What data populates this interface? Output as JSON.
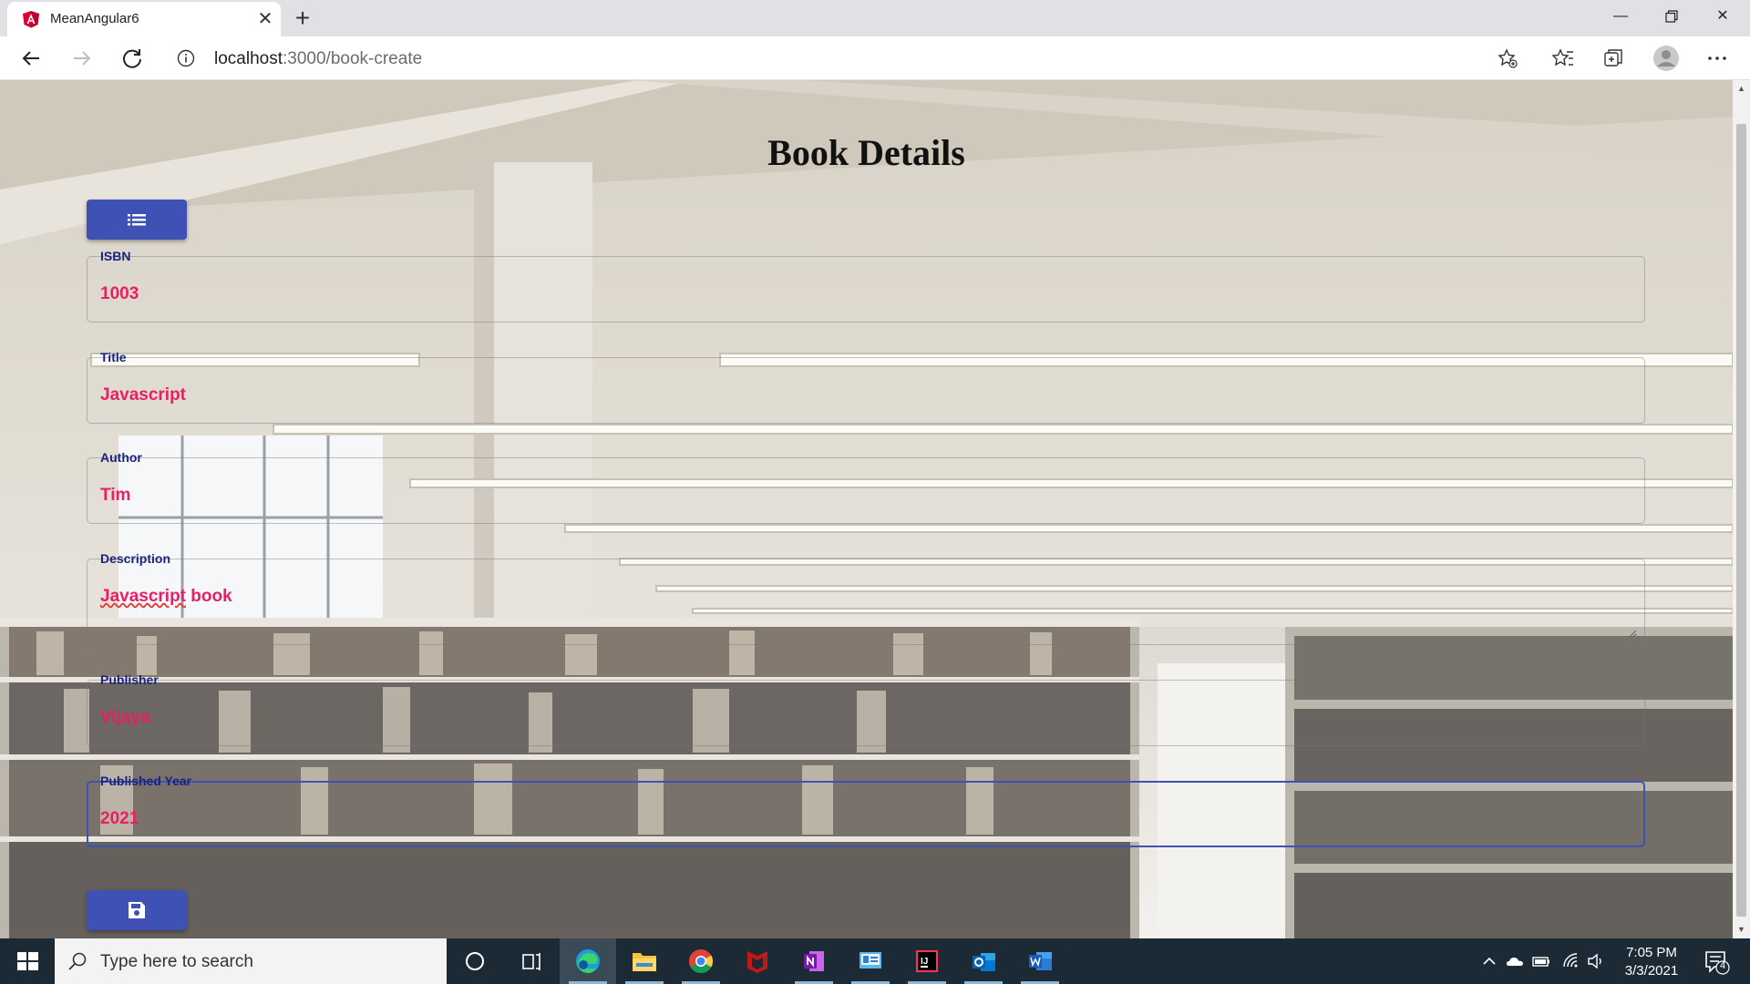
{
  "browser": {
    "tab_title": "MeanAngular6",
    "url_host": "localhost",
    "url_path": ":3000/book-create"
  },
  "page": {
    "heading": "Book Details",
    "fields": {
      "isbn": {
        "label": "ISBN",
        "value": "1003"
      },
      "title": {
        "label": "Title",
        "value": "Javascript"
      },
      "author": {
        "label": "Author",
        "value": "Tim"
      },
      "description": {
        "label": "Description",
        "value_word1": "Javascript",
        "value_rest": " book"
      },
      "publisher": {
        "label": "Publisher",
        "value": "Vijaya"
      },
      "published_year": {
        "label": "Published Year",
        "value": "2021"
      }
    }
  },
  "taskbar": {
    "search_placeholder": "Type here to search",
    "time": "7:05 PM",
    "date": "3/3/2021",
    "notification_count": "4"
  },
  "colors": {
    "primary": "#3f51b5",
    "label": "#1a237e",
    "value": "#e91e63"
  },
  "icons": [
    "angular-icon",
    "back-icon",
    "forward-icon",
    "refresh-icon",
    "info-icon",
    "add-favorite-icon",
    "favorites-icon",
    "collections-icon",
    "profile-icon",
    "more-icon",
    "list-icon",
    "save-icon",
    "windows-icon",
    "search-icon",
    "cortana-icon",
    "task-view-icon",
    "edge-icon",
    "file-explorer-icon",
    "chrome-icon",
    "mcafee-icon",
    "onenote-icon",
    "control-panel-icon",
    "intellij-icon",
    "outlook-icon",
    "word-icon"
  ]
}
